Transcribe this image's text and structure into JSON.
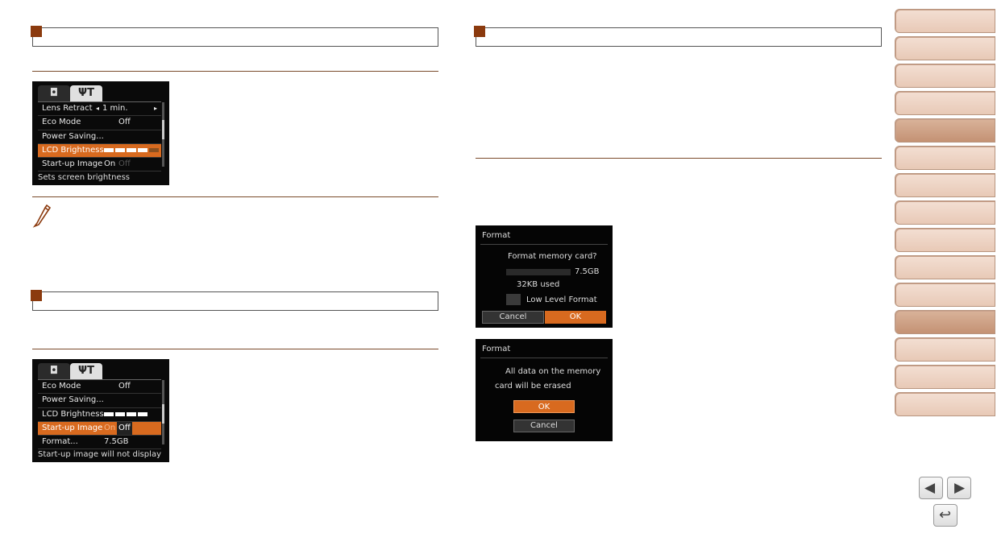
{
  "left_top_screen": {
    "menu": [
      {
        "label": "Lens Retract",
        "value": "1 min."
      },
      {
        "label": "Eco Mode",
        "value": "Off"
      },
      {
        "label": "Power Saving..."
      },
      {
        "label": "LCD Brightness"
      },
      {
        "label": "Start-up Image",
        "value": "On",
        "value2": "Off"
      }
    ],
    "footer": "Sets screen brightness"
  },
  "left_bottom_screen": {
    "menu": [
      {
        "label": "Eco Mode",
        "value": "Off"
      },
      {
        "label": "Power Saving..."
      },
      {
        "label": "LCD Brightness"
      },
      {
        "label": "Start-up Image",
        "value": "On",
        "value2": "Off"
      },
      {
        "label": "Format...",
        "value": "7.5GB"
      }
    ],
    "footer": "Start-up image will not display"
  },
  "format_dialog_1": {
    "title": "Format",
    "question": "Format memory card?",
    "capacity": "7.5GB",
    "used": "32KB used",
    "low_level": "Low Level Format",
    "cancel": "Cancel",
    "ok": "OK"
  },
  "format_dialog_2": {
    "title": "Format",
    "message_1": "All data on the memory",
    "message_2": "card will be erased",
    "ok": "OK",
    "cancel": "Cancel"
  },
  "sidebar": {
    "tab_count": 15,
    "active_index": 4,
    "active_index_2": 11
  },
  "nav": {
    "prev": "◀",
    "next": "▶",
    "back": "↩"
  },
  "colors": {
    "accent": "#d86a1f",
    "header_square": "#8b3a0e",
    "sidebar": "#e8c9b6"
  }
}
